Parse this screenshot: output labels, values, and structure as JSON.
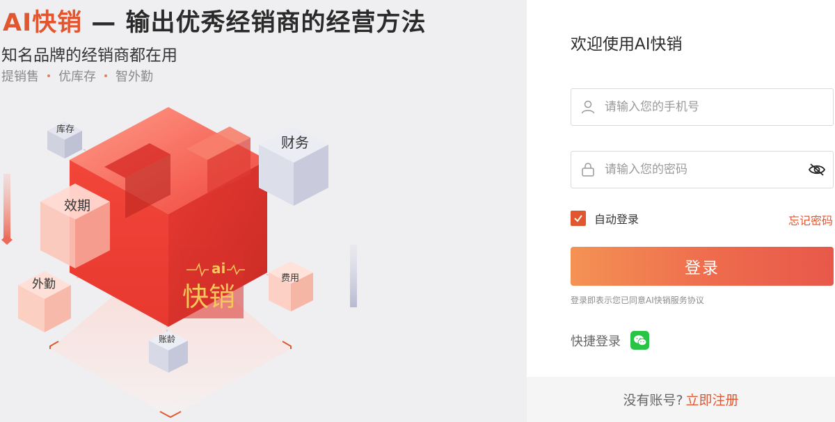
{
  "headline": {
    "brand": "AI快销",
    "dash": " — ",
    "tagline": "输出优秀经销商的经营方法"
  },
  "subline": "知名品牌的经销商都在用",
  "tags": [
    "提销售",
    "优库存",
    "智外勤"
  ],
  "illustration": {
    "cube_labels": {
      "inventory": "库存",
      "finance": "财务",
      "expiry": "效期",
      "field_work": "外勤",
      "expense": "费用",
      "aging": "账龄"
    },
    "logo_small": "ai",
    "logo_main": "快销"
  },
  "login": {
    "welcome": "欢迎使用AI快销",
    "phone_placeholder": "请输入您的手机号",
    "password_placeholder": "请输入您的密码",
    "remember_label": "自动登录",
    "remember_checked": true,
    "forgot_label": "忘记密码",
    "submit_label": "登录",
    "agreement": "登录即表示您已同意AI快销服务协议",
    "quick_login_label": "快捷登录",
    "quick_login_icon": "wechat-icon"
  },
  "footer": {
    "question": "没有账号?",
    "register_label": "立即注册"
  },
  "colors": {
    "accent": "#e2562f",
    "button_start": "#f49254",
    "button_end": "#e8584a",
    "wechat": "#28c445"
  }
}
